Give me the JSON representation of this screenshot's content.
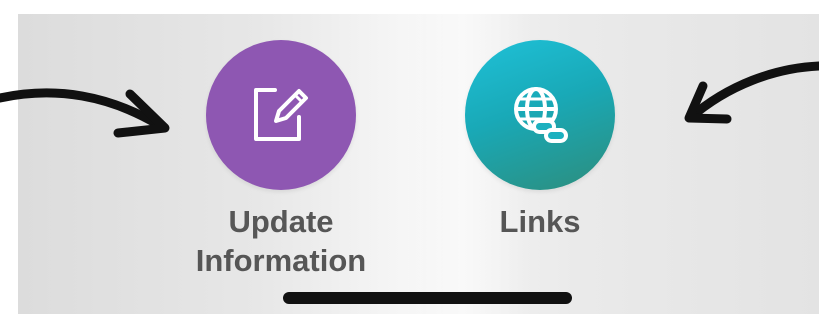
{
  "apps": [
    {
      "label_line1": "Update",
      "label_line2": "Information",
      "icon": "edit-note-icon",
      "color": "#8e57b2"
    },
    {
      "label": "Links",
      "icon": "globe-link-icon",
      "color": "#1fb4c4"
    }
  ],
  "annotations": {
    "arrow_color": "#111111",
    "left_arrow_icon": "hand-drawn-arrow-right",
    "right_arrow_icon": "hand-drawn-arrow-left"
  },
  "background_color": "#e8e8e8",
  "home_indicator_color": "#111111"
}
